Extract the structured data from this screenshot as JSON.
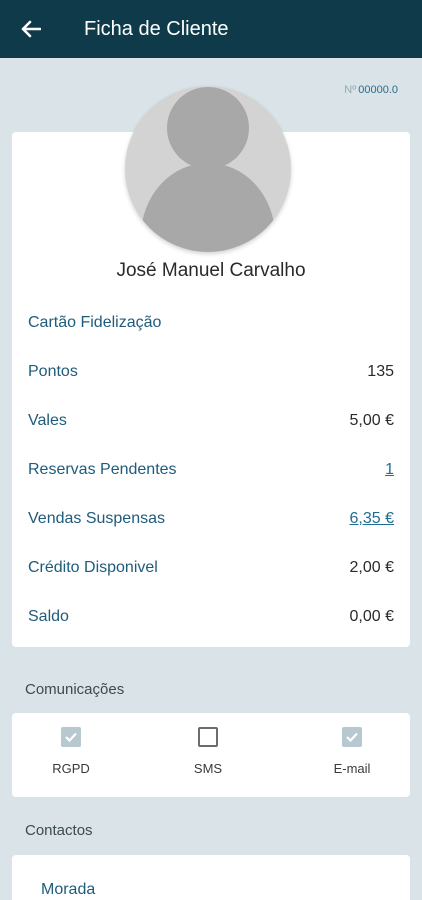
{
  "appbar": {
    "title": "Ficha de Cliente",
    "back_icon": "arrow-left-icon"
  },
  "client_number": {
    "prefix": "Nº",
    "value": "00000.0"
  },
  "profile": {
    "name": "José Manuel Carvalho",
    "loyalty_card_label": "Cartão Fidelização",
    "rows": [
      {
        "label": "Pontos",
        "value": "135",
        "link": false
      },
      {
        "label": "Vales",
        "value": "5,00 €",
        "link": false
      },
      {
        "label": "Reservas Pendentes",
        "value": "1",
        "link": true
      },
      {
        "label": "Vendas Suspensas",
        "value": "6,35 €",
        "link": true
      },
      {
        "label": "Crédito Disponivel",
        "value": "2,00 €",
        "link": false
      },
      {
        "label": "Saldo",
        "value": "0,00 €",
        "link": false
      }
    ]
  },
  "communications": {
    "title": "Comunicações",
    "options": [
      {
        "label": "RGPD",
        "checked": true
      },
      {
        "label": "SMS",
        "checked": false
      },
      {
        "label": "E-mail",
        "checked": true
      }
    ]
  },
  "contacts": {
    "title": "Contactos",
    "address_label": "Morada"
  },
  "colors": {
    "appbar": "#0e3a4a",
    "background": "#d9e3e8",
    "label": "#1f5b7a",
    "link": "#1f6d94"
  }
}
